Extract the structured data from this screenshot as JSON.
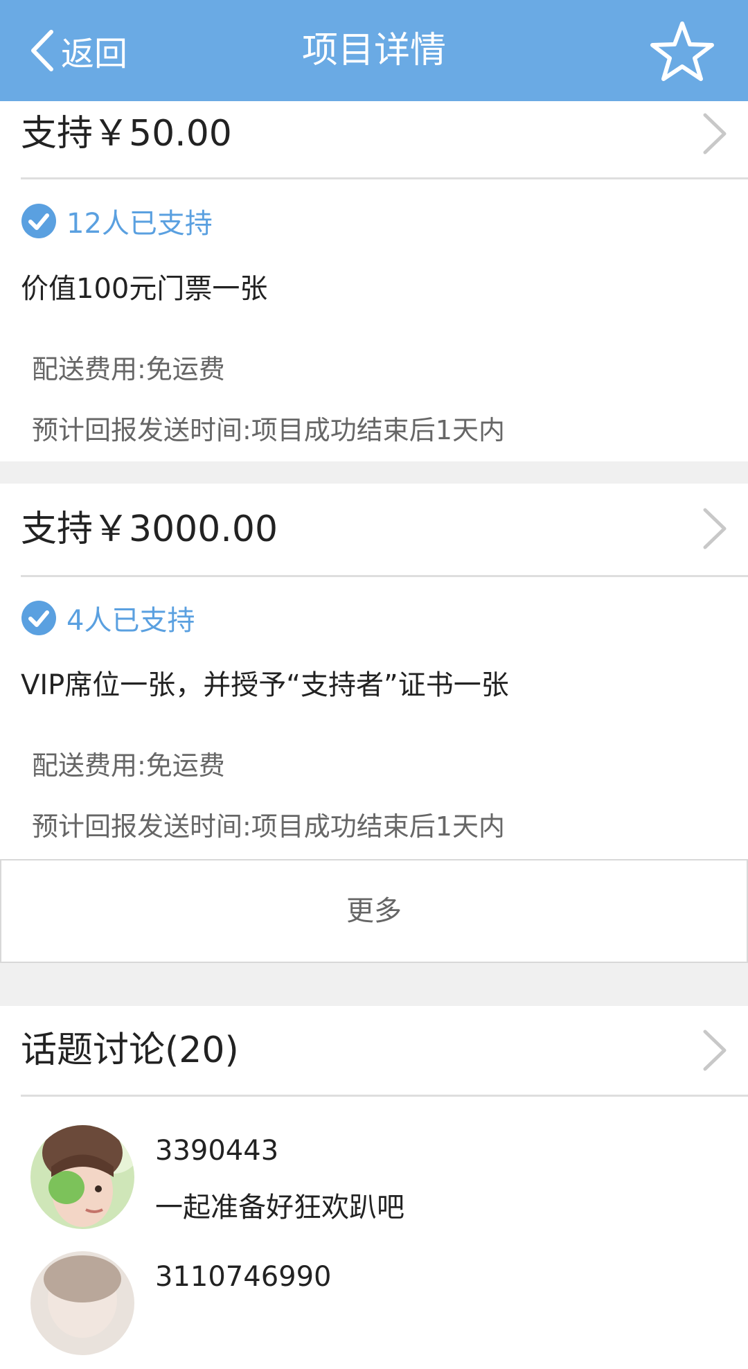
{
  "header": {
    "back_label": "返回",
    "title": "项目详情",
    "bg_color": "#6aaae4"
  },
  "tiers": [
    {
      "title": "支持￥50.00",
      "supporters": "12人已支持",
      "description": "价值100元门票一张",
      "shipping": "配送费用:免运费",
      "delivery_time": "预计回报发送时间:项目成功结束后1天内"
    },
    {
      "title": "支持￥3000.00",
      "supporters": "4人已支持",
      "description": "VIP席位一张，并授予“支持者”证书一张",
      "shipping": "配送费用:免运费",
      "delivery_time": "预计回报发送时间:项目成功结束后1天内"
    }
  ],
  "more_label": "更多",
  "discussion": {
    "title": "话题讨论(20)",
    "comments": [
      {
        "user": "3390443",
        "text": "一起准备好狂欢趴吧"
      },
      {
        "user": "3110746990",
        "text": ""
      }
    ]
  },
  "icons": {
    "back": "chevron-left-icon",
    "favorite": "star-outline-icon",
    "supporters": "check-circle-icon",
    "arrow": "chevron-right-icon"
  },
  "colors": {
    "accent": "#5aa0e0",
    "divider": "#dedede",
    "gap": "#f0f0f0"
  }
}
